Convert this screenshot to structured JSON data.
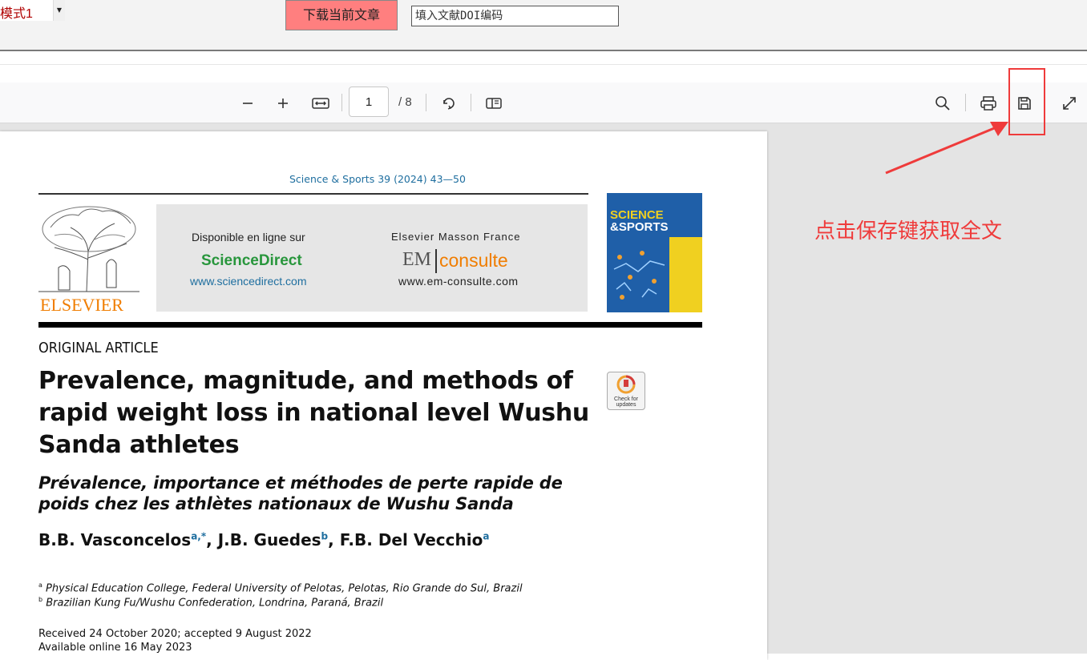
{
  "topbar": {
    "mode_value": "模式1",
    "download_label": "下载当前文章",
    "doi_placeholder": "填入文献DOI编码"
  },
  "pdf_toolbar": {
    "page_current": "1",
    "page_total": "/ 8",
    "icons": [
      "zoom-out-icon",
      "zoom-in-icon",
      "fit-width-icon",
      "rotate-icon",
      "page-view-icon",
      "search-icon",
      "print-icon",
      "save-icon",
      "fullscreen-icon"
    ]
  },
  "pdf_page": {
    "journal_ref": "Science & Sports 39 (2024) 43—50",
    "publisher": "ELSEVIER",
    "banner": {
      "available_online": "Disponible en ligne sur",
      "sciencedirect": "ScienceDirect",
      "sciencedirect_url": "www.sciencedirect.com",
      "masson": "Elsevier Masson France",
      "em": "EM",
      "consulte": "consulte",
      "em_url": "www.em-consulte.com"
    },
    "cover": {
      "line1": "SCIENCE",
      "line2": "&SPORTS"
    },
    "article_type": "ORIGINAL ARTICLE",
    "title": "Prevalence, magnitude, and methods of rapid weight loss in national level Wushu Sanda athletes",
    "title_fr": "Prévalence, importance et méthodes de perte rapide de poids chez les athlètes nationaux de Wushu Sanda",
    "check_updates": "Check for updates",
    "authors": [
      {
        "name": "B.B. Vasconcelos",
        "sup": "a,*",
        "sep": ", "
      },
      {
        "name": "J.B. Guedes",
        "sup": "b",
        "sep": ", "
      },
      {
        "name": "F.B. Del Vecchio",
        "sup": "a",
        "sep": ""
      }
    ],
    "affiliations": [
      {
        "sup": "a",
        "text": "Physical Education College, Federal University of Pelotas, Pelotas, Rio Grande do Sul, Brazil"
      },
      {
        "sup": "b",
        "text": "Brazilian Kung Fu/Wushu Confederation, Londrina, Paraná, Brazil"
      }
    ],
    "received": "Received 24 October 2020; accepted 9 August 2022",
    "available": "Available online 16 May 2023"
  },
  "annotation": {
    "text": "点击保存键获取全文",
    "color": "#ef3b3b"
  }
}
